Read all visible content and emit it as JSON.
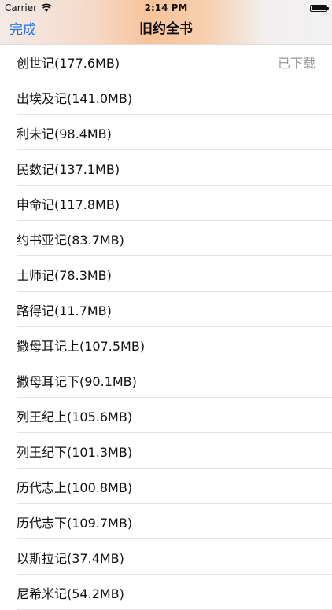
{
  "status_bar": {
    "carrier": "Carrier",
    "time": "2:14 PM"
  },
  "nav": {
    "done_label": "完成",
    "title": "旧约全书"
  },
  "books": [
    {
      "label": "创世记(177.6MB)",
      "status": "已下载"
    },
    {
      "label": "出埃及记(141.0MB)",
      "status": ""
    },
    {
      "label": "利未记(98.4MB)",
      "status": ""
    },
    {
      "label": "民数记(137.1MB)",
      "status": ""
    },
    {
      "label": "申命记(117.8MB)",
      "status": ""
    },
    {
      "label": "约书亚记(83.7MB)",
      "status": ""
    },
    {
      "label": "士师记(78.3MB)",
      "status": ""
    },
    {
      "label": "路得记(11.7MB)",
      "status": ""
    },
    {
      "label": "撒母耳记上(107.5MB)",
      "status": ""
    },
    {
      "label": "撒母耳记下(90.1MB)",
      "status": ""
    },
    {
      "label": "列王纪上(105.6MB)",
      "status": ""
    },
    {
      "label": "列王纪下(101.3MB)",
      "status": ""
    },
    {
      "label": "历代志上(100.8MB)",
      "status": ""
    },
    {
      "label": "历代志下(109.7MB)",
      "status": ""
    },
    {
      "label": "以斯拉记(37.4MB)",
      "status": ""
    },
    {
      "label": "尼希米记(54.2MB)",
      "status": ""
    }
  ]
}
